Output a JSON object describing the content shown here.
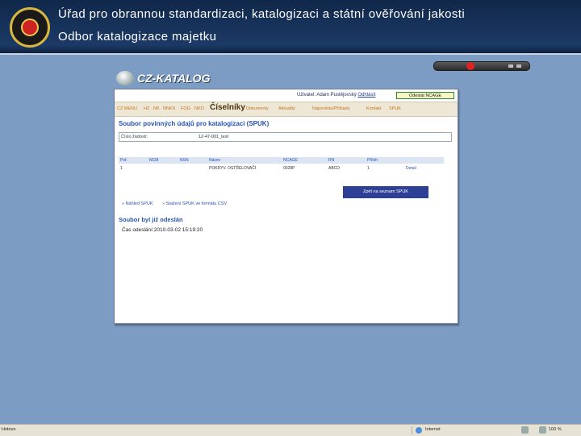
{
  "header": {
    "title": "Úřad pro obrannou standardizaci, katalogizaci a státní ověřování jakosti",
    "subtitle": "Odbor katalogizace majetku"
  },
  "app": {
    "logo_text": "CZ-KATALOG",
    "user_line": "Uživatel: Adam Pustějovský",
    "logout_link": "Odhlásit",
    "odeslat_button": "Odeslat NCAGE",
    "menu": {
      "items_left": [
        "CZ MENU",
        "HZ",
        "NK",
        "NNKS",
        "FOG",
        "NKO"
      ],
      "active": "Číselníky",
      "items_right": [
        "Dokumenty",
        "Aktuality",
        "Nápověda/Příklady",
        "Kontakt",
        "SPUK"
      ]
    },
    "page_title": "Soubor povinných údajů pro katalogizaci (SPUK)",
    "search_label": "Číslo žádosti:",
    "search_value": "12-47-001_test",
    "table": {
      "headers": [
        "Poř.",
        "NCM",
        "NSN",
        "Název",
        "NCAGE",
        "RN",
        "Příloh",
        ""
      ],
      "rows": [
        [
          "1",
          "",
          "",
          "POKRYV. OSTŘELOVAČÍ",
          "0028P",
          "ABCD",
          "1",
          "Detail"
        ]
      ]
    },
    "back_button": "Zpět na seznam SPUK",
    "links": [
      "» Náhled SPUK",
      "» Stažení SPUK ve formátu CSV"
    ],
    "sent_message": "Soubor byl již odeslán",
    "sent_time_label": "Čas odeslání:",
    "sent_time_value": "2010-03-02 15:19:20"
  },
  "statusbar": {
    "left": "Hotovo",
    "zone": "Internet",
    "zoom": "100 %"
  }
}
